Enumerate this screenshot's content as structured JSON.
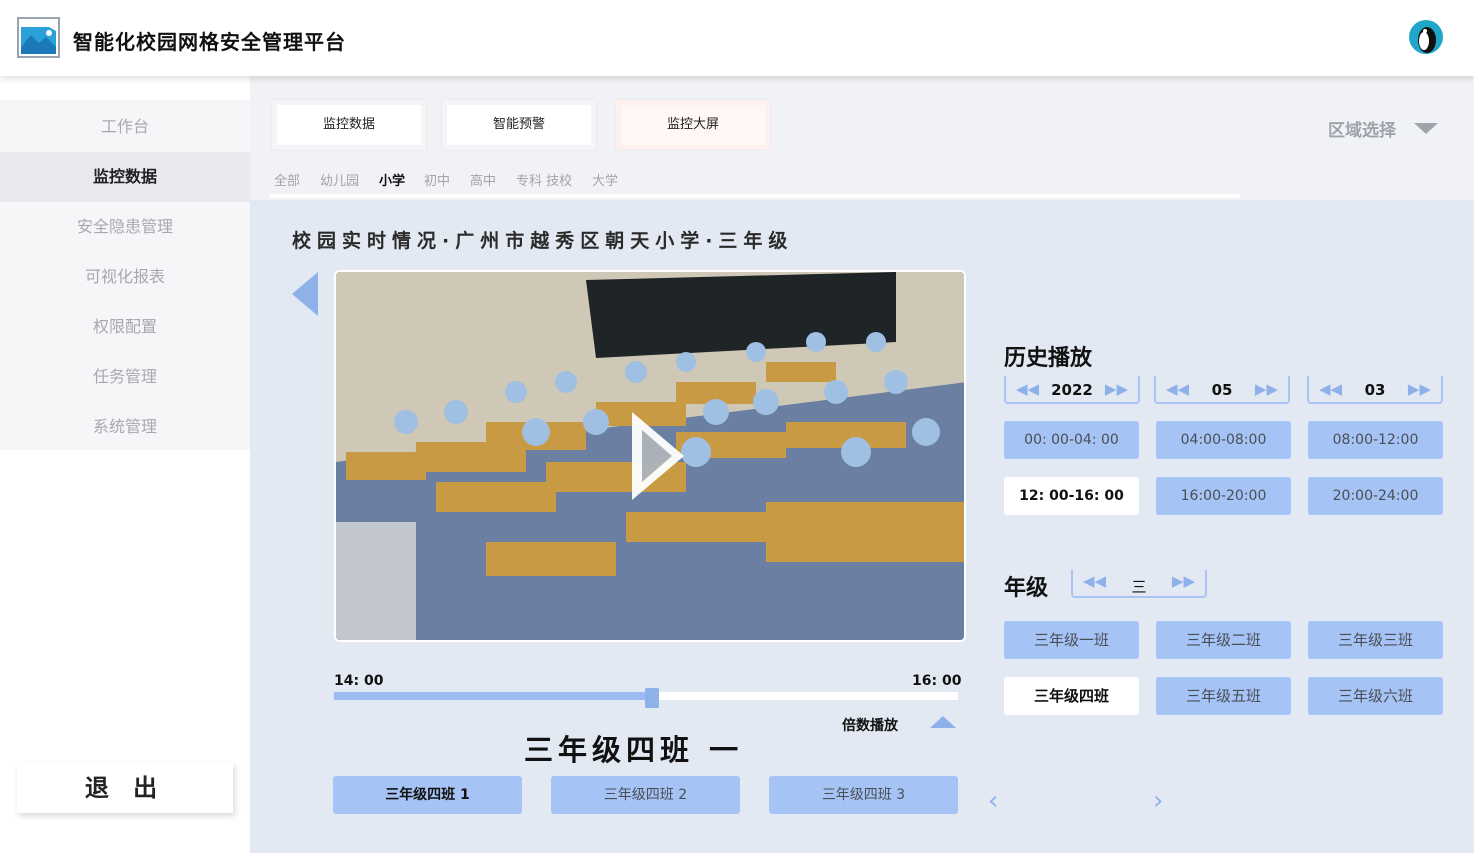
{
  "app": {
    "title": "智能化校园网格安全管理平台"
  },
  "sidebar": {
    "items": [
      {
        "label": "工作台",
        "active": false
      },
      {
        "label": "监控数据",
        "active": true
      },
      {
        "label": "安全隐患管理",
        "active": false
      },
      {
        "label": "可视化报表",
        "active": false
      },
      {
        "label": "权限配置",
        "active": false
      },
      {
        "label": "任务管理",
        "active": false
      },
      {
        "label": "系统管理",
        "active": false
      }
    ],
    "logout_label": "退 出"
  },
  "tabs": [
    {
      "label": "监控数据",
      "active": false
    },
    {
      "label": "智能预警",
      "active": false
    },
    {
      "label": "监控大屏",
      "active": true
    }
  ],
  "region_select_label": "区域选择",
  "levels": [
    {
      "label": "全部",
      "active": false
    },
    {
      "label": "幼儿园",
      "active": false
    },
    {
      "label": "小学",
      "active": true
    },
    {
      "label": "初中",
      "active": false
    },
    {
      "label": "高中",
      "active": false
    },
    {
      "label": "专科 技校",
      "active": false
    },
    {
      "label": "大学",
      "active": false
    }
  ],
  "live": {
    "title": "校园实时情况·广州市越秀区朝天小学·三年级",
    "time_start": "14: 00",
    "time_end": "16: 00",
    "progress": 0.51,
    "speed_label": "倍数播放",
    "class_title": "三年级四班 一",
    "cameras": [
      {
        "label": "三年级四班 1",
        "active": true
      },
      {
        "label": "三年级四班 2",
        "active": false
      },
      {
        "label": "三年级四班 3",
        "active": false
      }
    ]
  },
  "history": {
    "title": "历史播放",
    "year": "2022",
    "month": "05",
    "day": "03",
    "slots": [
      {
        "label": "00: 00-04: 00",
        "active": false
      },
      {
        "label": "04:00-08:00",
        "active": false
      },
      {
        "label": "08:00-12:00",
        "active": false
      },
      {
        "label": "12: 00-16: 00",
        "active": true
      },
      {
        "label": "16:00-20:00",
        "active": false
      },
      {
        "label": "20:00-24:00",
        "active": false
      }
    ]
  },
  "grade": {
    "title": "年级",
    "value": "三",
    "classes": [
      {
        "label": "三年级一班",
        "active": false
      },
      {
        "label": "三年级二班",
        "active": false
      },
      {
        "label": "三年级三班",
        "active": false
      },
      {
        "label": "三年级四班",
        "active": true
      },
      {
        "label": "三年级五班",
        "active": false
      },
      {
        "label": "三年级六班",
        "active": false
      }
    ]
  },
  "colors": {
    "accent": "#a6c3f5",
    "accent_dark": "#8fb1ea",
    "panel_bg": "#e3e9f3"
  }
}
